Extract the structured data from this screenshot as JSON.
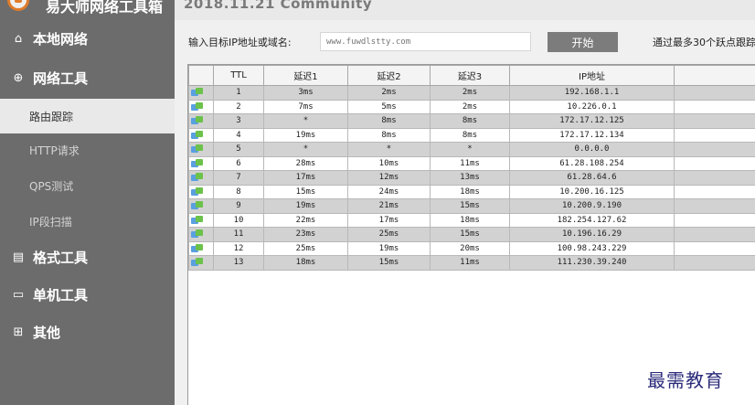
{
  "app": {
    "title": "易大师网络工具箱",
    "version_text": "2018.11.21   Community"
  },
  "sidebar": {
    "categories": [
      {
        "label": "本地网络",
        "icon": "home-icon"
      },
      {
        "label": "网络工具",
        "icon": "globe-icon"
      },
      {
        "label": "格式工具",
        "icon": "document-icon"
      },
      {
        "label": "单机工具",
        "icon": "monitor-icon"
      },
      {
        "label": "其他",
        "icon": "grid-icon"
      }
    ],
    "subitems": [
      {
        "label": "路由跟踪",
        "active": true
      },
      {
        "label": "HTTP请求",
        "active": false
      },
      {
        "label": "QPS测试",
        "active": false
      },
      {
        "label": "IP段扫描",
        "active": false
      }
    ]
  },
  "toolbar": {
    "target_label": "输入目标IP地址或域名:",
    "target_placeholder": "www.fuwdlstty.com",
    "start_button": "开始",
    "hint": "通过最多30个跃点跟踪"
  },
  "table": {
    "columns": [
      "",
      "TTL",
      "延迟1",
      "延迟2",
      "延迟3",
      "IP地址",
      ""
    ],
    "rows": [
      {
        "ttl": "1",
        "d1": "3ms",
        "d2": "2ms",
        "d3": "2ms",
        "ip": "192.168.1.1"
      },
      {
        "ttl": "2",
        "d1": "7ms",
        "d2": "5ms",
        "d3": "2ms",
        "ip": "10.226.0.1"
      },
      {
        "ttl": "3",
        "d1": "*",
        "d2": "8ms",
        "d3": "8ms",
        "ip": "172.17.12.125"
      },
      {
        "ttl": "4",
        "d1": "19ms",
        "d2": "8ms",
        "d3": "8ms",
        "ip": "172.17.12.134"
      },
      {
        "ttl": "5",
        "d1": "*",
        "d2": "*",
        "d3": "*",
        "ip": "0.0.0.0"
      },
      {
        "ttl": "6",
        "d1": "28ms",
        "d2": "10ms",
        "d3": "11ms",
        "ip": "61.28.108.254"
      },
      {
        "ttl": "7",
        "d1": "17ms",
        "d2": "12ms",
        "d3": "13ms",
        "ip": "61.28.64.6"
      },
      {
        "ttl": "8",
        "d1": "15ms",
        "d2": "24ms",
        "d3": "18ms",
        "ip": "10.200.16.125"
      },
      {
        "ttl": "9",
        "d1": "19ms",
        "d2": "21ms",
        "d3": "15ms",
        "ip": "10.200.9.190"
      },
      {
        "ttl": "10",
        "d1": "22ms",
        "d2": "17ms",
        "d3": "18ms",
        "ip": "182.254.127.62"
      },
      {
        "ttl": "11",
        "d1": "23ms",
        "d2": "25ms",
        "d3": "15ms",
        "ip": "10.196.16.29"
      },
      {
        "ttl": "12",
        "d1": "25ms",
        "d2": "19ms",
        "d3": "20ms",
        "ip": "100.98.243.229"
      },
      {
        "ttl": "13",
        "d1": "18ms",
        "d2": "15ms",
        "d3": "11ms",
        "ip": "111.230.39.240"
      }
    ]
  },
  "watermark": "最需教育"
}
